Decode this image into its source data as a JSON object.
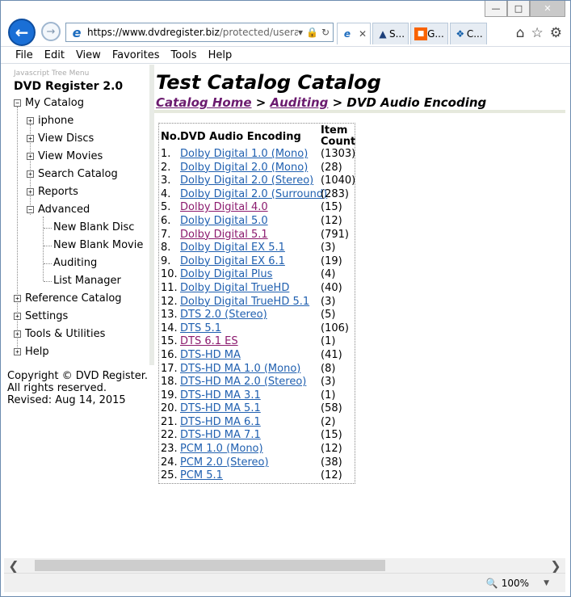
{
  "browser": {
    "url_host": "https://www.dvdregister.biz",
    "url_path": "/protected/useraudi",
    "tabs": [
      {
        "label": ""
      },
      {
        "label": "S..."
      },
      {
        "label": "G..."
      },
      {
        "label": "C..."
      }
    ],
    "menu": [
      "File",
      "Edit",
      "View",
      "Favorites",
      "Tools",
      "Help"
    ],
    "zoom": "100%"
  },
  "nav": {
    "header": "Javascript Tree Menu",
    "title": "DVD Register 2.0",
    "items": {
      "my_catalog": "My Catalog",
      "iphone": "iphone",
      "view_discs": "View Discs",
      "view_movies": "View Movies",
      "search_catalog": "Search Catalog",
      "reports": "Reports",
      "advanced": "Advanced",
      "new_blank_disc": "New Blank Disc",
      "new_blank_movie": "New Blank Movie",
      "auditing": "Auditing",
      "list_manager": "List Manager",
      "reference_catalog": "Reference Catalog",
      "settings": "Settings",
      "tools_utilities": "Tools & Utilities",
      "help": "Help"
    },
    "footer": {
      "line1": "Copyright © DVD Register.",
      "line2": "All rights reserved.",
      "line3": "Revised: Aug 14, 2015"
    }
  },
  "page": {
    "title": "Test Catalog Catalog",
    "crumb_home": "Catalog Home",
    "crumb_sep1": " > ",
    "crumb_auditing": "Auditing",
    "crumb_current": " > DVD Audio Encoding"
  },
  "table": {
    "col_no": "No.",
    "col_encoding": "DVD Audio Encoding",
    "col_count_1": "Item",
    "col_count_2": "Count",
    "rows": [
      {
        "n": "1.",
        "label": "Dolby Digital 1.0 (Mono)",
        "count": "(1303)"
      },
      {
        "n": "2.",
        "label": "Dolby Digital 2.0 (Mono)",
        "count": "(28)"
      },
      {
        "n": "3.",
        "label": "Dolby Digital 2.0 (Stereo)",
        "count": "(1040)"
      },
      {
        "n": "4.",
        "label": "Dolby Digital 2.0 (Surround)",
        "count": "(283)"
      },
      {
        "n": "5.",
        "label": "Dolby Digital 4.0",
        "count": "(15)"
      },
      {
        "n": "6.",
        "label": "Dolby Digital 5.0",
        "count": "(12)"
      },
      {
        "n": "7.",
        "label": "Dolby Digital 5.1",
        "count": "(791)"
      },
      {
        "n": "8.",
        "label": "Dolby Digital EX 5.1",
        "count": "(3)"
      },
      {
        "n": "9.",
        "label": "Dolby Digital EX 6.1",
        "count": "(19)"
      },
      {
        "n": "10.",
        "label": "Dolby Digital Plus",
        "count": "(4)"
      },
      {
        "n": "11.",
        "label": "Dolby Digital TrueHD",
        "count": "(40)"
      },
      {
        "n": "12.",
        "label": "Dolby Digital TrueHD 5.1",
        "count": "(3)"
      },
      {
        "n": "13.",
        "label": "DTS 2.0 (Stereo)",
        "count": "(5)"
      },
      {
        "n": "14.",
        "label": "DTS 5.1",
        "count": "(106)"
      },
      {
        "n": "15.",
        "label": "DTS 6.1 ES",
        "count": "(1)"
      },
      {
        "n": "16.",
        "label": "DTS-HD MA",
        "count": "(41)"
      },
      {
        "n": "17.",
        "label": "DTS-HD MA 1.0 (Mono)",
        "count": "(8)"
      },
      {
        "n": "18.",
        "label": "DTS-HD MA 2.0 (Stereo)",
        "count": "(3)"
      },
      {
        "n": "19.",
        "label": "DTS-HD MA 3.1",
        "count": "(1)"
      },
      {
        "n": "20.",
        "label": "DTS-HD MA 5.1",
        "count": "(58)"
      },
      {
        "n": "21.",
        "label": "DTS-HD MA 6.1",
        "count": "(2)"
      },
      {
        "n": "22.",
        "label": "DTS-HD MA 7.1",
        "count": "(15)"
      },
      {
        "n": "23.",
        "label": "PCM 1.0 (Mono)",
        "count": "(12)"
      },
      {
        "n": "24.",
        "label": "PCM 2.0 (Stereo)",
        "count": "(38)"
      },
      {
        "n": "25.",
        "label": "PCM 5.1",
        "count": "(12)"
      }
    ]
  },
  "colors": {
    "link": "#2060b0",
    "visited": "#8b1a6e",
    "crumb": "#6b1b6f"
  }
}
